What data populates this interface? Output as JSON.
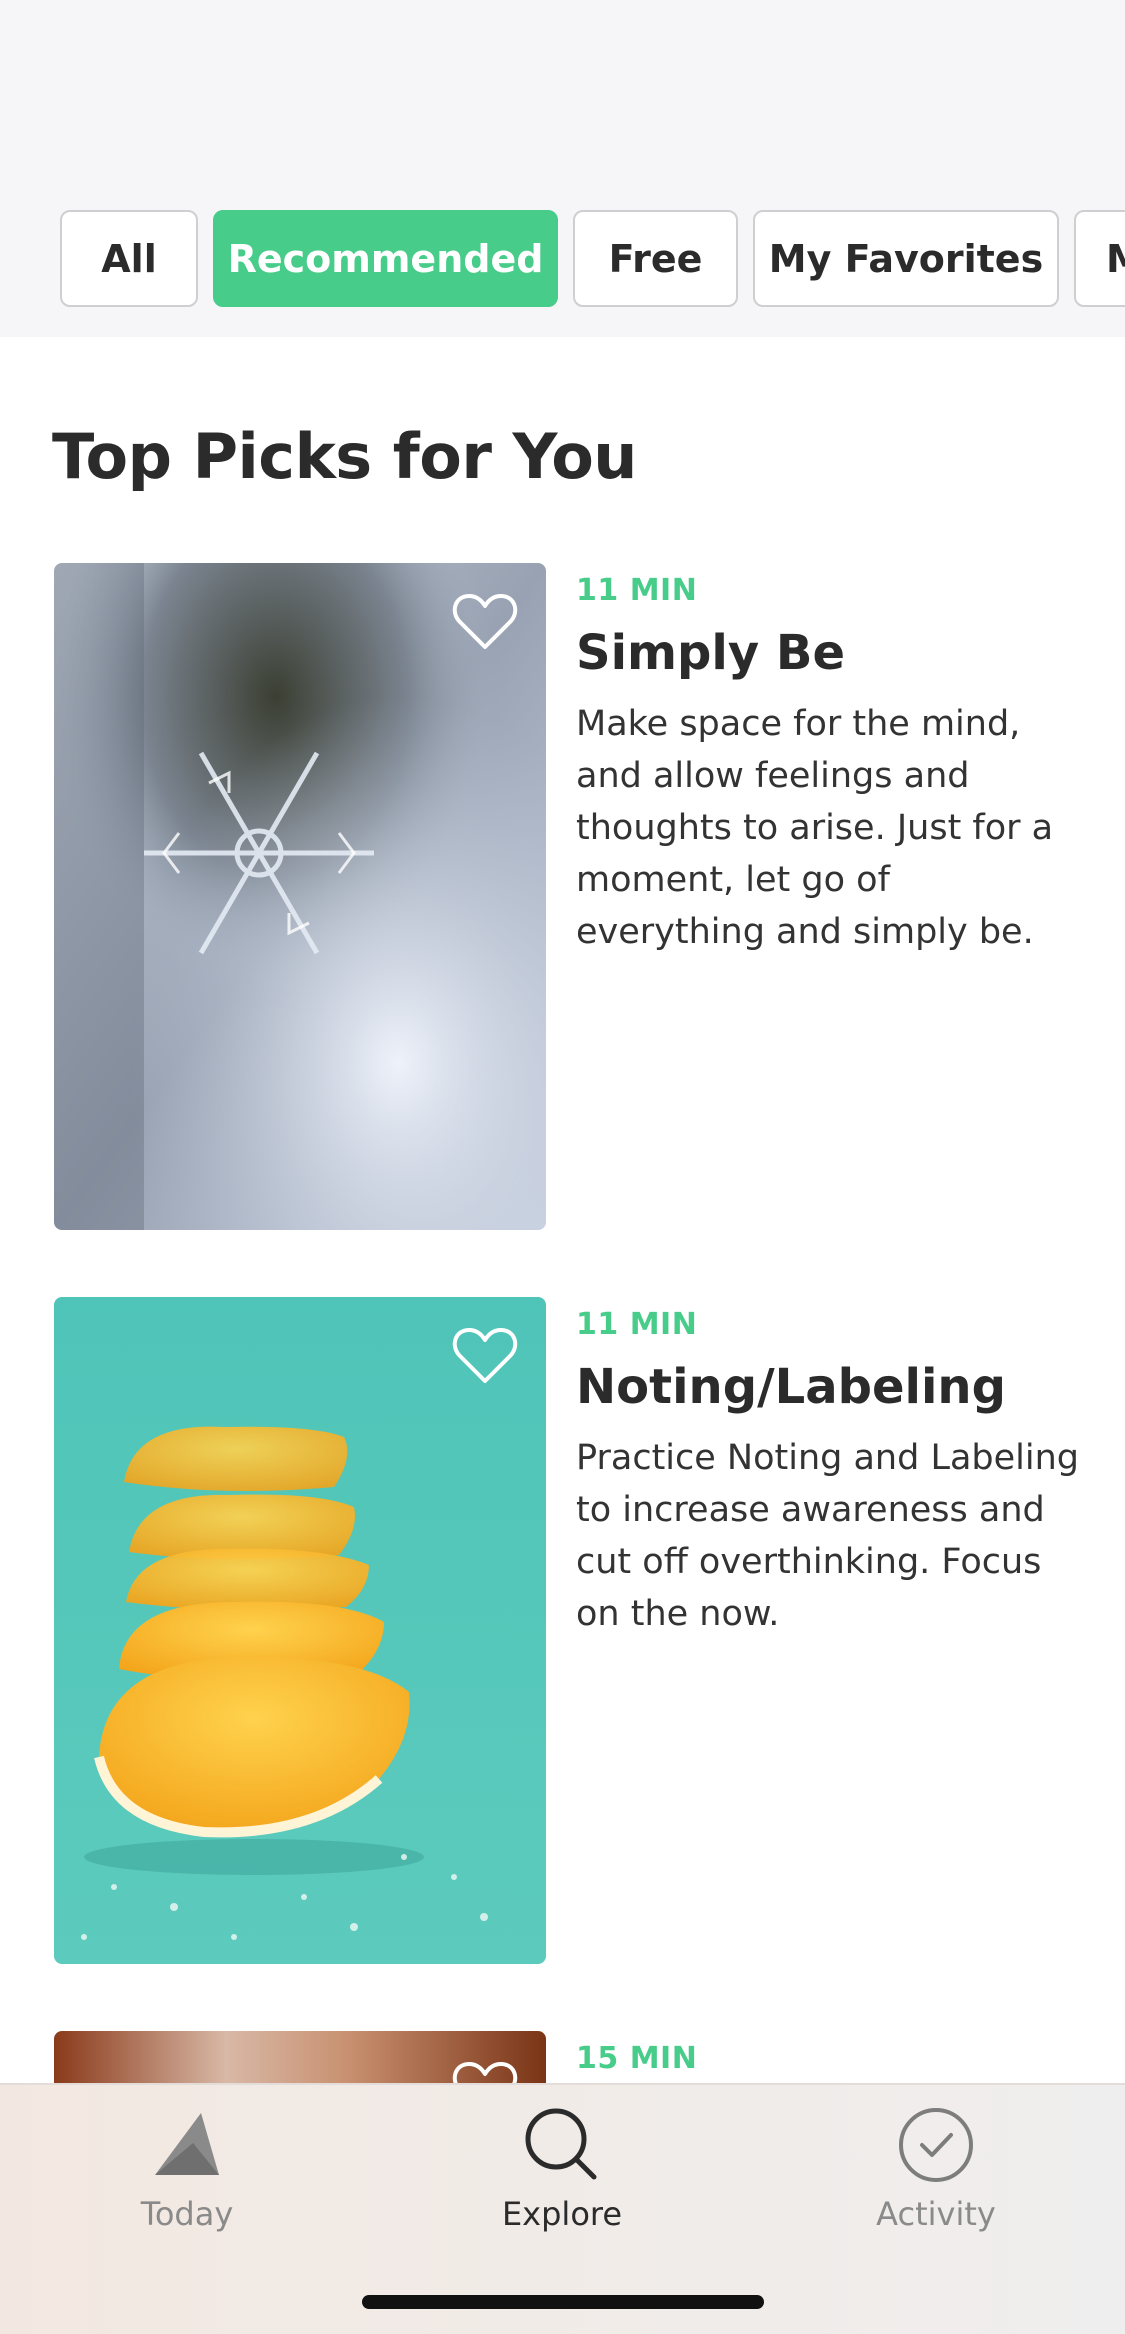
{
  "filters": [
    {
      "label": "All",
      "active": false
    },
    {
      "label": "Recommended",
      "active": true
    },
    {
      "label": "Free",
      "active": false
    },
    {
      "label": "My Favorites",
      "active": false
    },
    {
      "label": "M",
      "active": false
    }
  ],
  "section_title": "Top Picks for You",
  "cards": [
    {
      "duration": "11 MIN",
      "title": "Simply Be",
      "description": "Make space for the mind, and allow feelings and thoughts to arise. Just for a moment, let go of everything and simply be.",
      "image": "snowflake-photo",
      "favorite_icon": "heart-outline-icon"
    },
    {
      "duration": "11 MIN",
      "title": "Noting/Labeling",
      "description": "Practice Noting and Labeling to increase awareness and cut off overthinking. Focus on the now.",
      "image": "orange-slices-photo",
      "favorite_icon": "heart-outline-icon"
    },
    {
      "duration": "15 MIN",
      "title": "",
      "description": "",
      "image": "partial-photo",
      "favorite_icon": "heart-outline-icon"
    }
  ],
  "tabbar": {
    "items": [
      {
        "label": "Today",
        "icon": "mountain-icon",
        "active": false
      },
      {
        "label": "Explore",
        "icon": "search-icon",
        "active": true
      },
      {
        "label": "Activity",
        "icon": "check-circle-icon",
        "active": false
      }
    ]
  },
  "colors": {
    "accent": "#47cc8a",
    "text": "#2b2b2b",
    "background": "#ffffff",
    "header_background": "#f6f6f8"
  }
}
